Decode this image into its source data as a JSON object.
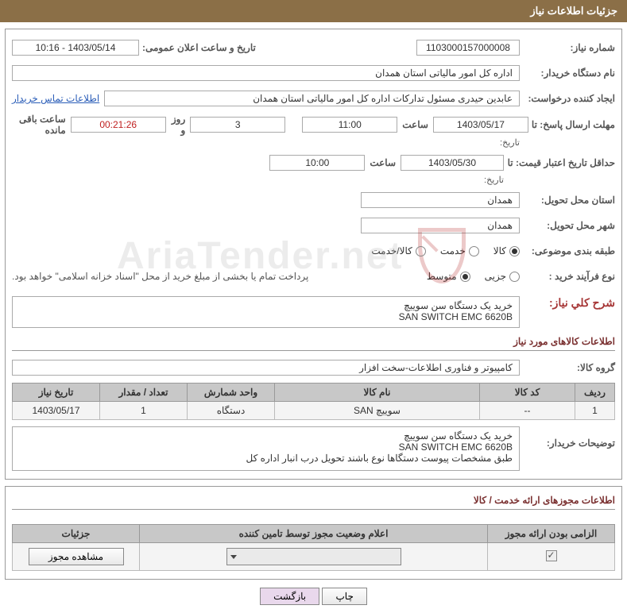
{
  "header": {
    "title": "جزئیات اطلاعات نیاز"
  },
  "fields": {
    "need_number_label": "شماره نیاز:",
    "need_number": "1103000157000008",
    "announce_label": "تاریخ و ساعت اعلان عمومی:",
    "announce_value": "1403/05/14 - 10:16",
    "buyer_org_label": "نام دستگاه خریدار:",
    "buyer_org": "اداره کل امور مالیاتی استان همدان",
    "requester_label": "ایجاد کننده درخواست:",
    "requester": "عابدین حیدری مسئول تدارکات اداره کل امور مالیاتی استان همدان",
    "contact_link": "اطلاعات تماس خریدار",
    "deadline_label": "مهلت ارسال پاسخ: تا",
    "deadline_sub": "تاریخ:",
    "deadline_date": "1403/05/17",
    "hour_lbl": "ساعت",
    "deadline_time": "11:00",
    "days_count": "3",
    "days_suffix": "روز و",
    "countdown": "00:21:26",
    "countdown_suffix": "ساعت باقی مانده",
    "validity_label": "حداقل تاریخ اعتبار قیمت: تا",
    "validity_sub": "تاریخ:",
    "validity_date": "1403/05/30",
    "validity_time": "10:00",
    "province_label": "استان محل تحویل:",
    "province": "همدان",
    "city_label": "شهر محل تحویل:",
    "city": "همدان",
    "category_label": "طبقه بندی موضوعی:",
    "cat_goods": "کالا",
    "cat_service": "خدمت",
    "cat_both": "کالا/خدمت",
    "process_label": "نوع فرآیند خرید :",
    "proc_partial": "جزیی",
    "proc_medium": "متوسط",
    "process_note": "پرداخت تمام یا بخشی از مبلغ خرید از محل \"اسناد خزانه اسلامی\" خواهد بود.",
    "desc_label": "شرح کلي نیاز:",
    "desc_line1": "خرید یک دستگاه سن سوییچ",
    "desc_line2": "SAN SWITCH EMC 6620B",
    "section_items": "اطلاعات کالاهای مورد نیاز",
    "group_label": "گروه کالا:",
    "group_value": "کامپیوتر و فناوری اطلاعات-سخت افزار",
    "buyer_desc_label": "توضیحات خریدار:",
    "buyer_desc_l1": "خرید یک دستگاه سن سوییچ",
    "buyer_desc_l2": "SAN SWITCH EMC 6620B",
    "buyer_desc_l3": "طبق مشخصات پیوست دستگاها نوع باشند تحویل درب انبار اداره کل"
  },
  "table": {
    "headers": {
      "row": "ردیف",
      "code": "کد کالا",
      "name": "نام کالا",
      "unit": "واحد شمارش",
      "qty": "تعداد / مقدار",
      "date": "تاریخ نیاز"
    },
    "rows": [
      {
        "row": "1",
        "code": "--",
        "name": "سوییچ SAN",
        "unit": "دستگاه",
        "qty": "1",
        "date": "1403/05/17"
      }
    ]
  },
  "license": {
    "title": "اطلاعات مجوزهای ارائه خدمت / کالا",
    "headers": {
      "mandatory": "الزامی بودن ارائه مجوز",
      "status": "اعلام وضعیت مجوز توسط تامین کننده",
      "details": "جزئیات"
    },
    "view_btn": "مشاهده مجوز"
  },
  "buttons": {
    "print": "چاپ",
    "back": "بازگشت"
  },
  "watermark": "AriaTender.net"
}
